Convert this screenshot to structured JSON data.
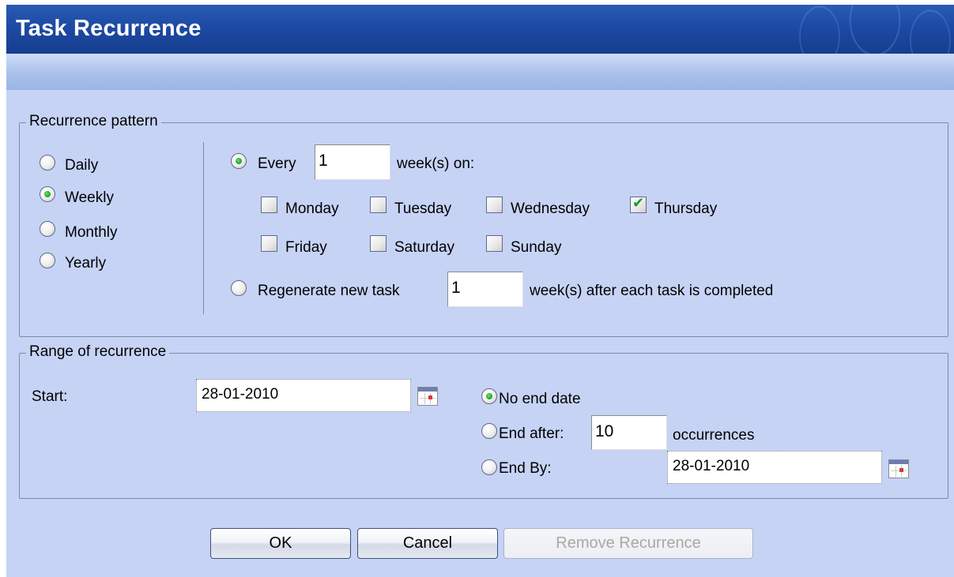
{
  "window": {
    "title": "Task Recurrence"
  },
  "recurrence_pattern": {
    "legend": "Recurrence pattern",
    "frequency_options": [
      {
        "label": "Daily",
        "checked": false
      },
      {
        "label": "Weekly",
        "checked": true
      },
      {
        "label": "Monthly",
        "checked": false
      },
      {
        "label": "Yearly",
        "checked": false
      }
    ],
    "every": {
      "label": "Every",
      "value": "1",
      "suffix": "week(s) on:",
      "checked": true
    },
    "days": [
      {
        "label": "Monday",
        "checked": false
      },
      {
        "label": "Tuesday",
        "checked": false
      },
      {
        "label": "Wednesday",
        "checked": false
      },
      {
        "label": "Thursday",
        "checked": true
      },
      {
        "label": "Friday",
        "checked": false
      },
      {
        "label": "Saturday",
        "checked": false
      },
      {
        "label": "Sunday",
        "checked": false
      }
    ],
    "regenerate": {
      "label": "Regenerate new task",
      "value": "1",
      "suffix": "week(s) after each task is completed",
      "checked": false
    }
  },
  "range_of_recurrence": {
    "legend": "Range of recurrence",
    "start_label": "Start:",
    "start_date": "28-01-2010",
    "no_end_date": {
      "label": "No end date",
      "checked": true
    },
    "end_after": {
      "label": "End after:",
      "value": "10",
      "suffix": "occurrences",
      "checked": false
    },
    "end_by": {
      "label": "End By:",
      "date": "28-01-2010",
      "checked": false
    }
  },
  "buttons": {
    "ok": "OK",
    "cancel": "Cancel",
    "remove_recurrence": "Remove Recurrence"
  },
  "colors": {
    "title_bar": "#1d4aa3",
    "dialog_background": "#c6d3f5",
    "check_accent": "#1c9c2a"
  }
}
